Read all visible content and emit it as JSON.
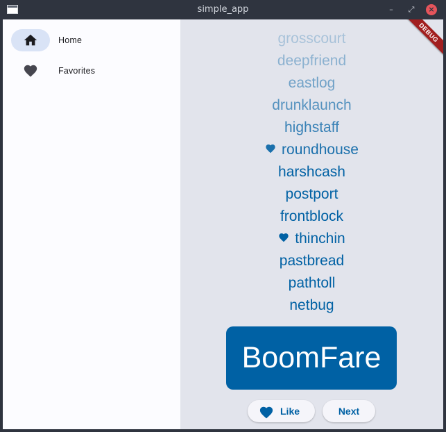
{
  "window": {
    "title": "simple_app",
    "minimize_glyph": "–",
    "maximize_glyph": "⤢",
    "close_glyph": "×"
  },
  "sidebar": {
    "items": [
      {
        "label": "Home",
        "icon": "home-icon",
        "selected": true
      },
      {
        "label": "Favorites",
        "icon": "heart-icon",
        "selected": false
      }
    ]
  },
  "history": {
    "items": [
      {
        "text": "grosscourt",
        "favorite": false,
        "opacity": 0.25
      },
      {
        "text": "deepfriend",
        "favorite": false,
        "opacity": 0.38
      },
      {
        "text": "eastlog",
        "favorite": false,
        "opacity": 0.5
      },
      {
        "text": "drunklaunch",
        "favorite": false,
        "opacity": 0.62
      },
      {
        "text": "highstaff",
        "favorite": false,
        "opacity": 0.75
      },
      {
        "text": "roundhouse",
        "favorite": true,
        "opacity": 0.88
      },
      {
        "text": "harshcash",
        "favorite": false,
        "opacity": 1
      },
      {
        "text": "postport",
        "favorite": false,
        "opacity": 1
      },
      {
        "text": "frontblock",
        "favorite": false,
        "opacity": 1
      },
      {
        "text": "thinchin",
        "favorite": true,
        "opacity": 1
      },
      {
        "text": "pastbread",
        "favorite": false,
        "opacity": 1
      },
      {
        "text": "pathtoll",
        "favorite": false,
        "opacity": 1
      },
      {
        "text": "netbug",
        "favorite": false,
        "opacity": 1
      }
    ]
  },
  "current_pair": "BoomFare",
  "buttons": {
    "like_label": "Like",
    "next_label": "Next"
  },
  "debug_banner": "DEBUG",
  "colors": {
    "primary": "#0061a4",
    "nav_selected": "#d9e3f6",
    "main_background": "#e2e4ec",
    "debug_banner": "#a21f1f"
  }
}
